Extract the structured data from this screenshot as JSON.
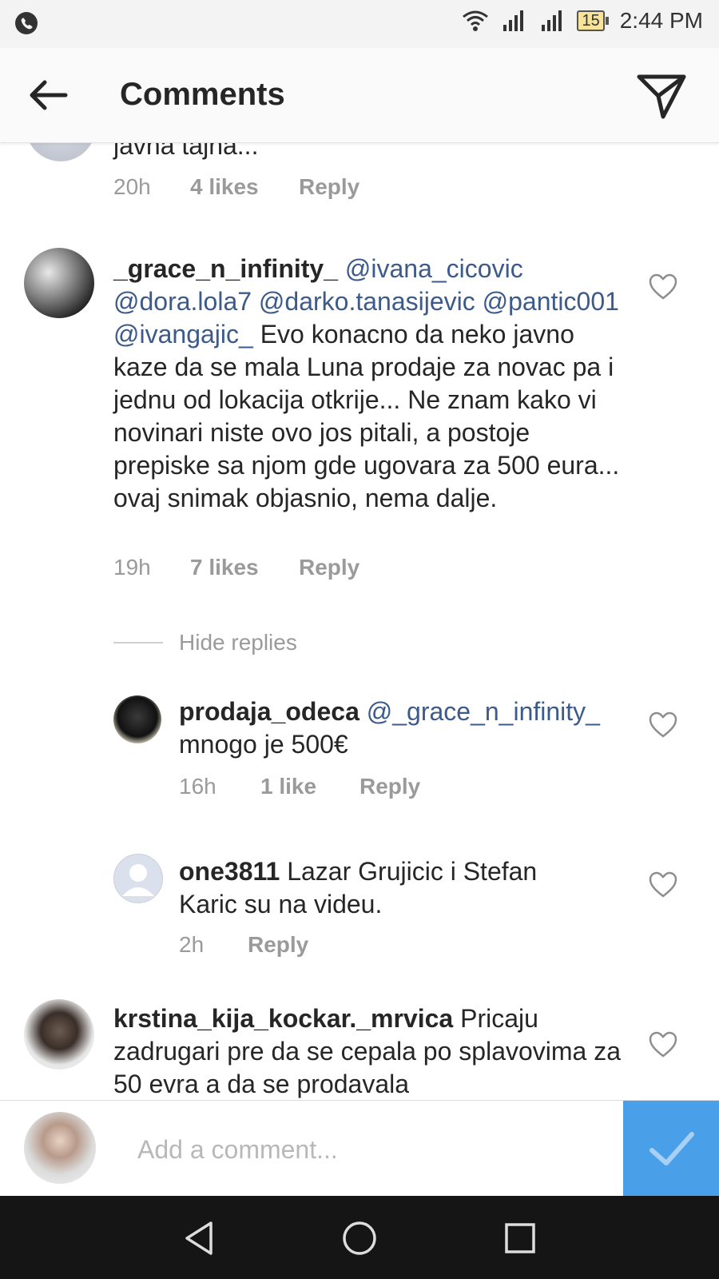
{
  "status_bar": {
    "time": "2:44 PM",
    "battery": "15"
  },
  "header": {
    "title": "Comments"
  },
  "comments": [
    {
      "text_tail": "javna tajna...",
      "time": "20h",
      "likes": "4 likes",
      "reply": "Reply"
    },
    {
      "username": "_grace_n_infinity_",
      "mentions": [
        "@ivana_cicovic",
        "@dora.lola7",
        "@darko.tanasijevic",
        "@pantic001",
        "@ivangajic_"
      ],
      "text": "Evo konacno da neko javno kaze da se mala Luna prodaje za novac pa i jednu od lokacija otkrije... Ne znam kako vi novinari niste ovo jos pitali, a postoje prepiske sa njom gde ugovara za 500 eura... ovaj snimak objasnio, nema dalje.",
      "time": "19h",
      "likes": "7 likes",
      "reply": "Reply",
      "hide_replies": "Hide replies",
      "replies": [
        {
          "username": "prodaja_odeca",
          "mention": "@_grace_n_infinity_",
          "text": "mnogo je 500€",
          "time": "16h",
          "likes": "1 like",
          "reply": "Reply"
        },
        {
          "username": "one3811",
          "text": "Lazar Grujicic i Stefan Karic su na videu.",
          "time": "2h",
          "reply": "Reply"
        }
      ]
    },
    {
      "username": "krstina_kija_kockar._mrvica",
      "text": "Pricaju zadrugari pre da se cepala po splavovima za 50 evra a da se prodavala"
    }
  ],
  "composer": {
    "placeholder": "Add a comment..."
  },
  "colors": {
    "accent": "#4aa0e8",
    "mention": "#3c5a8a",
    "meta": "#9a9a9a"
  },
  "icons": {
    "back": "arrow-left-icon",
    "send": "paper-plane-icon",
    "like": "heart-outline-icon",
    "post": "checkmark-icon",
    "nav_back": "triangle-back-icon",
    "nav_home": "circle-home-icon",
    "nav_recents": "square-recents-icon"
  }
}
